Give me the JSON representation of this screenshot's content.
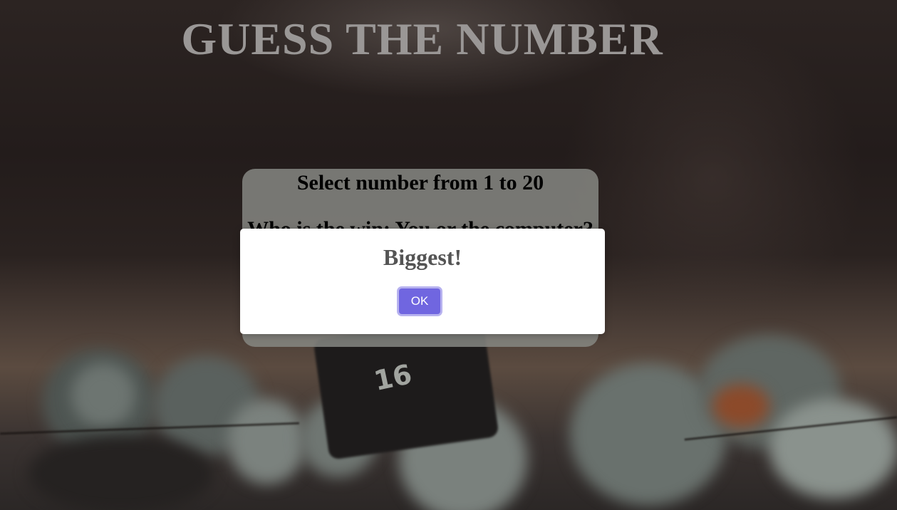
{
  "page": {
    "title": "GUESS THE NUMBER"
  },
  "game": {
    "select_prompt": "Select number from 1 to 20",
    "winner_prompt": "Who is the win: You or the computer?"
  },
  "dialog": {
    "message": "Biggest!",
    "ok_label": "OK"
  },
  "background": {
    "die_number": "16"
  },
  "colors": {
    "accent": "#7066e0",
    "title": "#9a9796",
    "card": "#868783",
    "dialog_text": "#545454"
  }
}
